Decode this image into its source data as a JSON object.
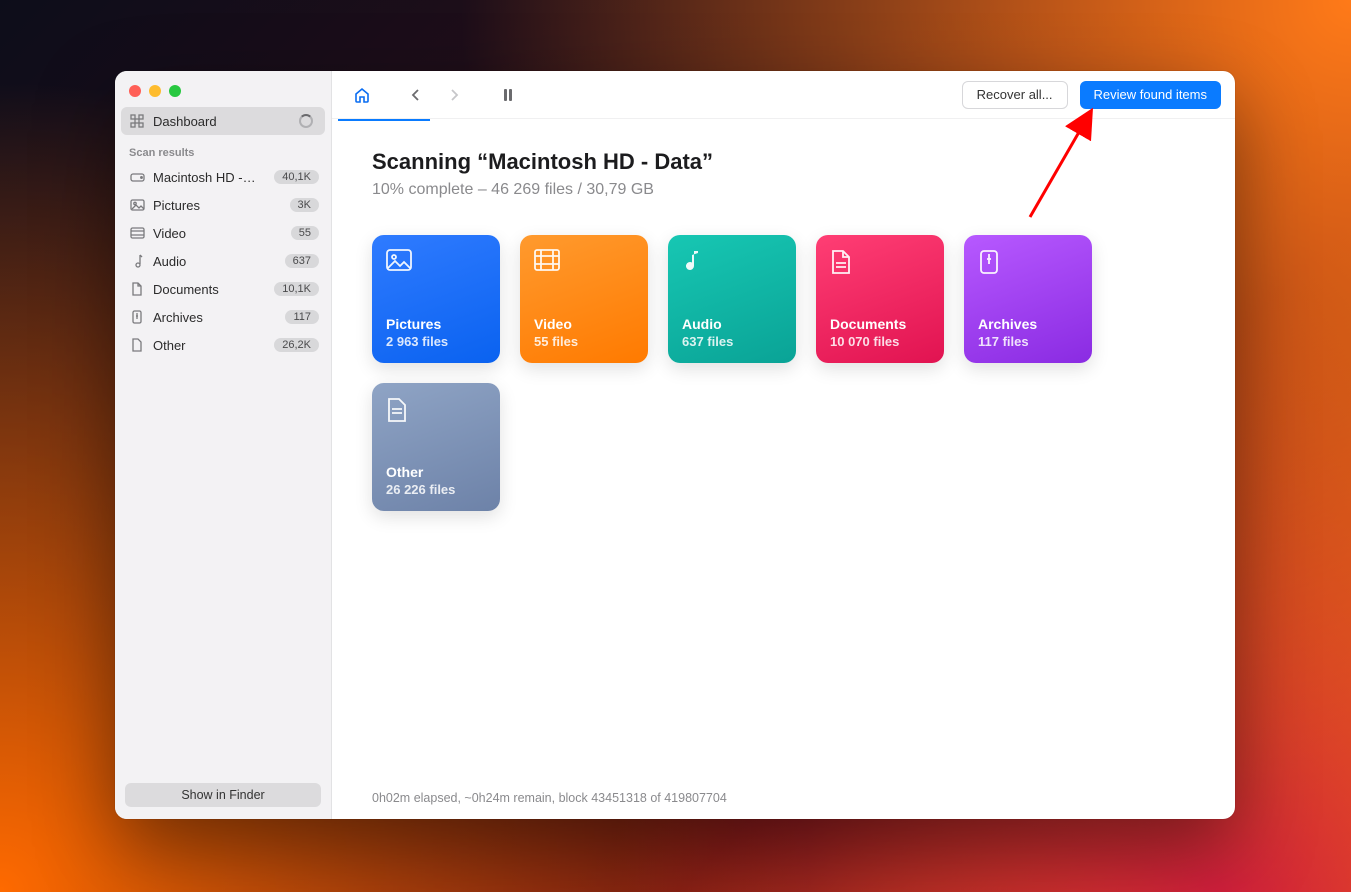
{
  "sidebar": {
    "dashboard_label": "Dashboard",
    "section_label": "Scan results",
    "items": [
      {
        "label": "Macintosh HD -…",
        "count": "40,1K"
      },
      {
        "label": "Pictures",
        "count": "3K"
      },
      {
        "label": "Video",
        "count": "55"
      },
      {
        "label": "Audio",
        "count": "637"
      },
      {
        "label": "Documents",
        "count": "10,1K"
      },
      {
        "label": "Archives",
        "count": "117"
      },
      {
        "label": "Other",
        "count": "26,2K"
      }
    ],
    "finder_button": "Show in Finder"
  },
  "toolbar": {
    "recover_all": "Recover all...",
    "review_found": "Review found items"
  },
  "scan": {
    "title": "Scanning “Macintosh HD - Data”",
    "subtitle": "10% complete – 46 269 files / 30,79 GB"
  },
  "cards": {
    "pictures": {
      "name": "Pictures",
      "count": "2 963 files"
    },
    "video": {
      "name": "Video",
      "count": "55 files"
    },
    "audio": {
      "name": "Audio",
      "count": "637 files"
    },
    "documents": {
      "name": "Documents",
      "count": "10 070 files"
    },
    "archives": {
      "name": "Archives",
      "count": "117 files"
    },
    "other": {
      "name": "Other",
      "count": "26 226 files"
    }
  },
  "status": "0h02m elapsed, ~0h24m remain, block 43451318 of 419807704"
}
